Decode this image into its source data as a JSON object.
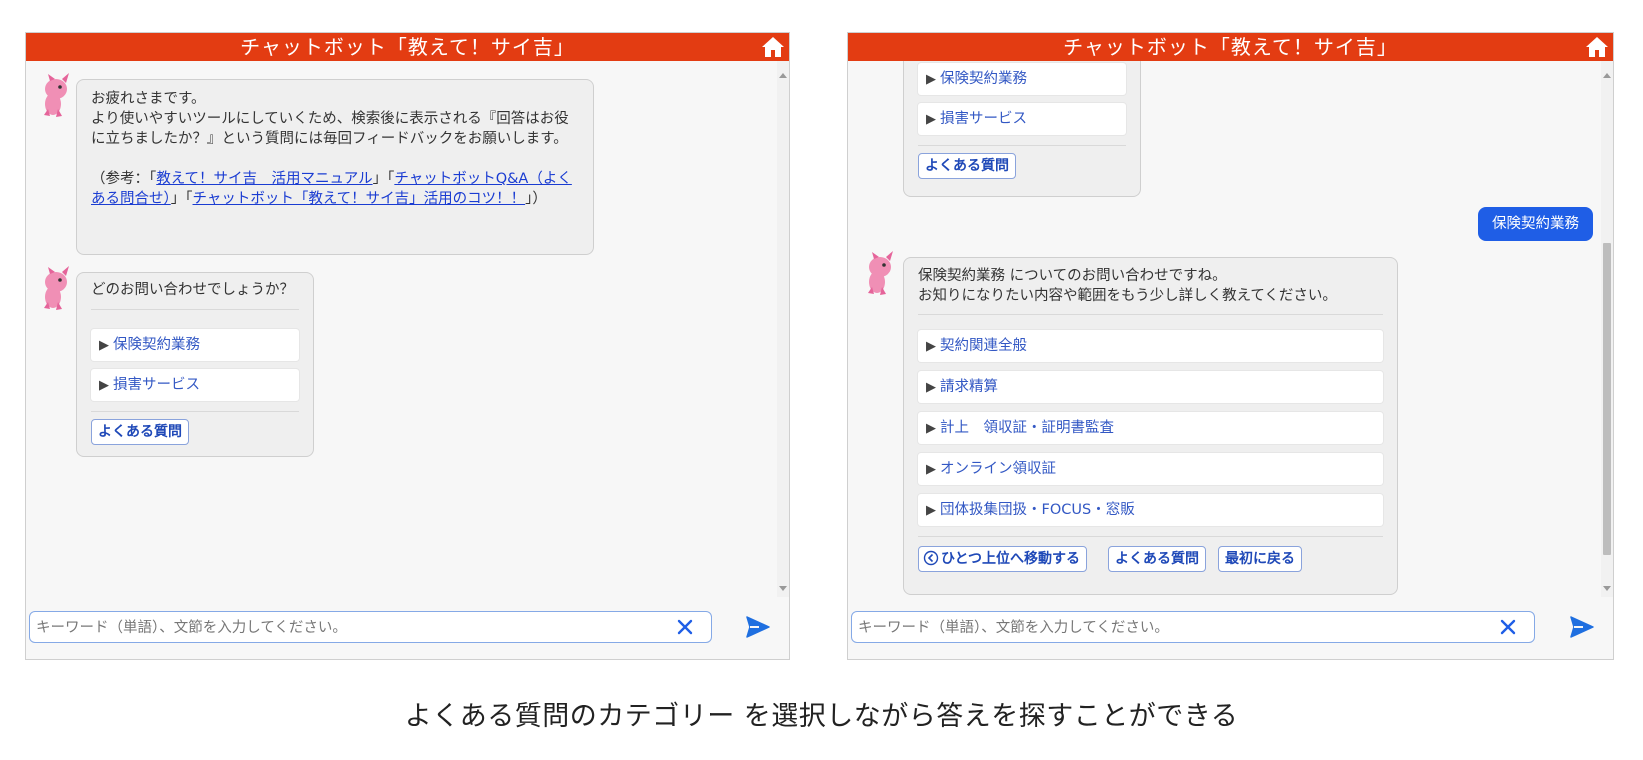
{
  "left": {
    "title": "チャットボット「教えて！サイ吉」",
    "greeting": {
      "line1": "お疲れさまです。",
      "line2": "より使いやすいツールにしていくため、検索後に表示される『回答はお役に立ちましたか？』という質問には毎回フィードバックをお願いします。",
      "ref_prefix": "（参考：「",
      "link1": "教えて！サイ吉　活用マニュアル",
      "ref_mid1": "」「",
      "link2": "チャットボットQ&A（よくある問合せ）",
      "ref_mid2": "」「",
      "link3": "チャットボット「教えて！サイ吉」活用のコツ！！",
      "ref_suffix": "」）"
    },
    "question": "どのお問い合わせでしょうか？",
    "options": [
      "保険契約業務",
      "損害サービス"
    ],
    "faq_button": "よくある質問",
    "input_placeholder": "キーワード（単語）、文節を入力してください。"
  },
  "right": {
    "title": "チャットボット「教えて！サイ吉」",
    "prev_options": [
      "保険契約業務",
      "損害サービス"
    ],
    "prev_faq_button": "よくある質問",
    "user_message": "保険契約業務",
    "bot_reply_line1": "保険契約業務 についてのお問い合わせですね。",
    "bot_reply_line2": "お知りになりたい内容や範囲をもう少し詳しく教えてください。",
    "options": [
      "契約関連全般",
      "請求精算",
      "計上　領収証・証明書監査",
      "オンライン領収証",
      "団体扱集団扱・FOCUS・窓販"
    ],
    "btn_up": "ひとつ上位へ移動する",
    "btn_faq": "よくある質問",
    "btn_start": "最初に戻る",
    "input_placeholder": "キーワード（単語）、文節を入力してください。"
  },
  "caption": "よくある質問のカテゴリー を選択しながら答えを探すことができる",
  "colors": {
    "header": "#e33c12",
    "user_bubble": "#1f5ee6",
    "link": "#1a3cd2",
    "option_text": "#3358c4",
    "send": "#1f6fe0"
  },
  "icons": [
    "home-icon",
    "mascot-avatar",
    "clear-icon",
    "send-icon",
    "up-circle-icon"
  ]
}
